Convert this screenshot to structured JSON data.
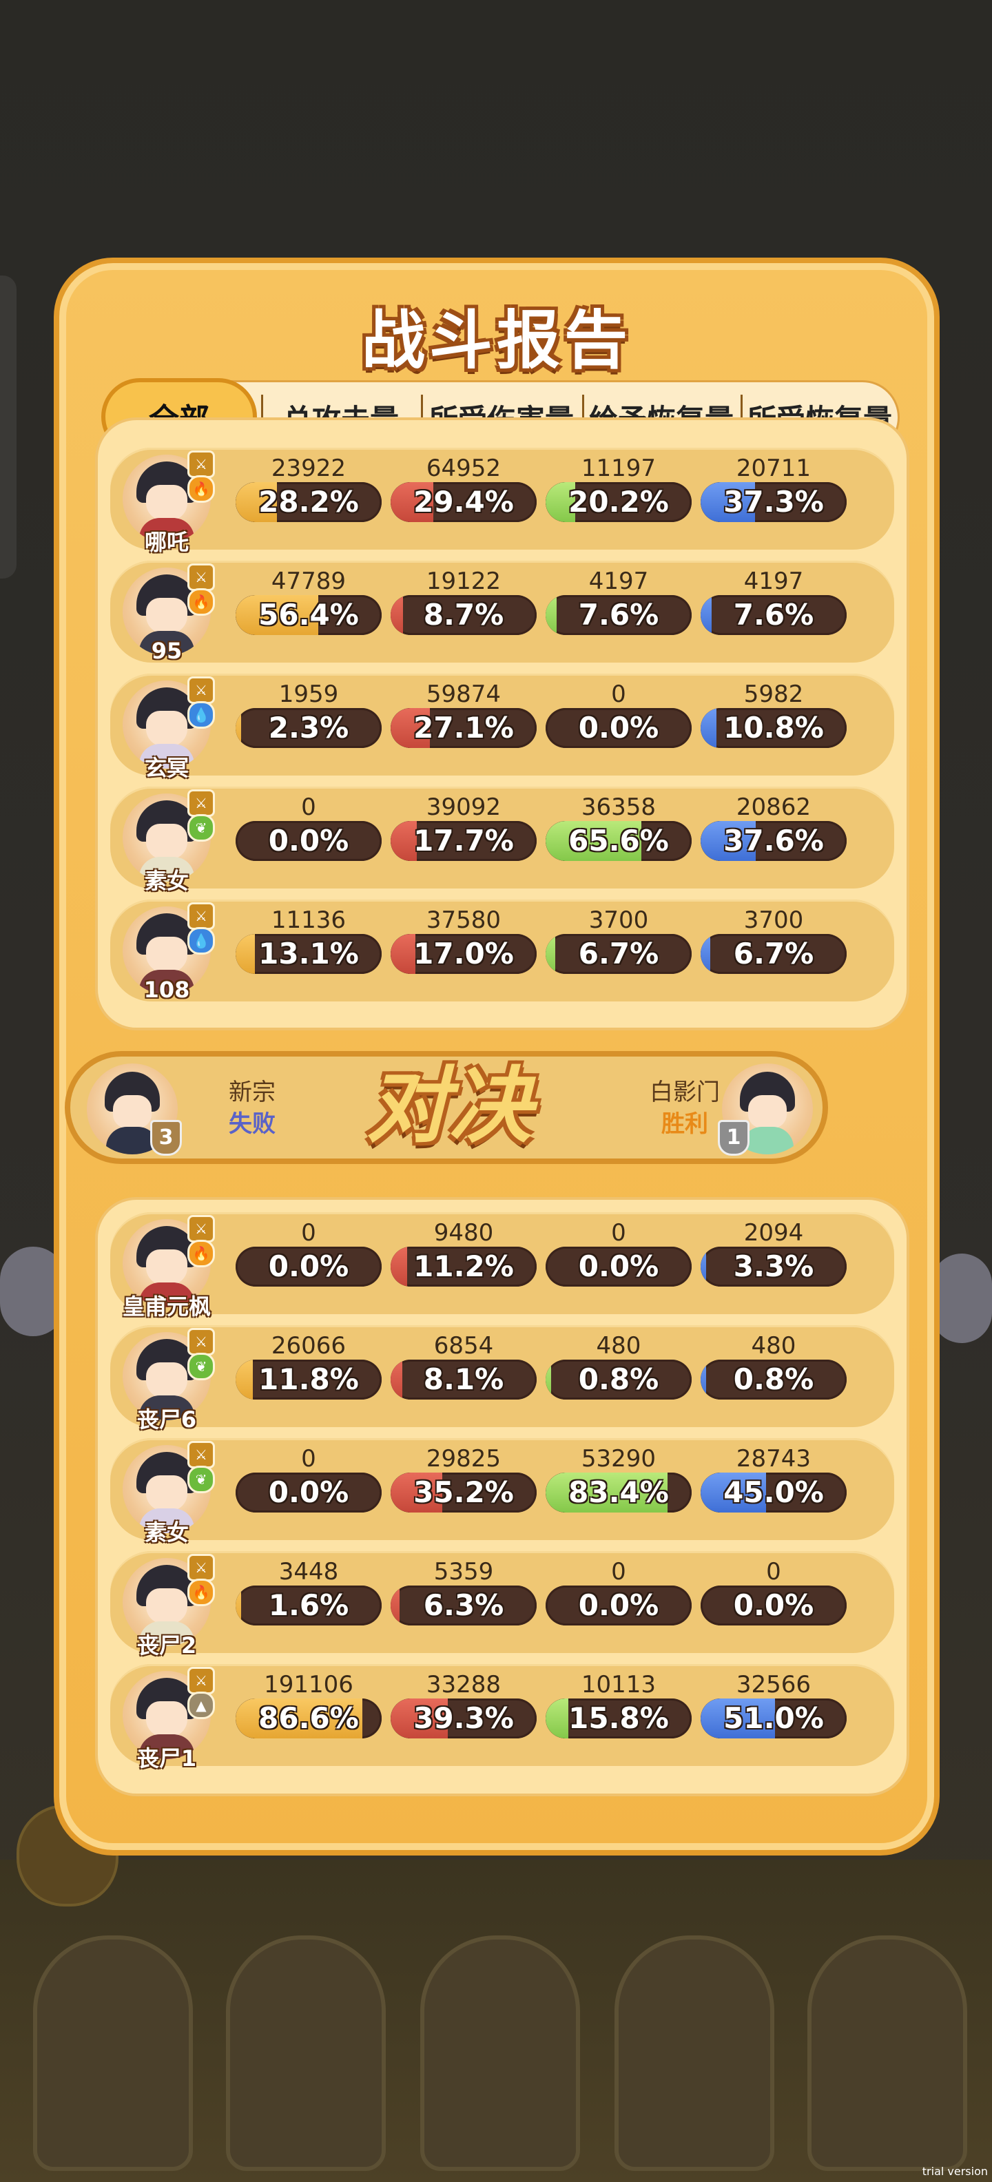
{
  "title": "战斗报告",
  "tabs": [
    "全部",
    "总攻击量",
    "所受伤害量",
    "给予恢复量",
    "所受恢复量"
  ],
  "versus": {
    "left": {
      "team": "新宗",
      "result": "失败",
      "rank": "3"
    },
    "logo": "对决",
    "right": {
      "team": "白影门",
      "result": "胜利",
      "rank": "1"
    }
  },
  "team_top": [
    {
      "name": "哪吒",
      "element": "fire",
      "stats": [
        {
          "v": "23922",
          "p": "28.2%",
          "f": 0.282
        },
        {
          "v": "64952",
          "p": "29.4%",
          "f": 0.294
        },
        {
          "v": "11197",
          "p": "20.2%",
          "f": 0.202
        },
        {
          "v": "20711",
          "p": "37.3%",
          "f": 0.373
        }
      ]
    },
    {
      "name": "95",
      "element": "fire",
      "stats": [
        {
          "v": "47789",
          "p": "56.4%",
          "f": 0.564
        },
        {
          "v": "19122",
          "p": "8.7%",
          "f": 0.087
        },
        {
          "v": "4197",
          "p": "7.6%",
          "f": 0.076
        },
        {
          "v": "4197",
          "p": "7.6%",
          "f": 0.076
        }
      ]
    },
    {
      "name": "玄冥",
      "element": "water",
      "stats": [
        {
          "v": "1959",
          "p": "2.3%",
          "f": 0.023
        },
        {
          "v": "59874",
          "p": "27.1%",
          "f": 0.271
        },
        {
          "v": "0",
          "p": "0.0%",
          "f": 0
        },
        {
          "v": "5982",
          "p": "10.8%",
          "f": 0.108
        }
      ]
    },
    {
      "name": "素女",
      "element": "wood",
      "stats": [
        {
          "v": "0",
          "p": "0.0%",
          "f": 0
        },
        {
          "v": "39092",
          "p": "17.7%",
          "f": 0.177
        },
        {
          "v": "36358",
          "p": "65.6%",
          "f": 0.656
        },
        {
          "v": "20862",
          "p": "37.6%",
          "f": 0.376
        }
      ]
    },
    {
      "name": "108",
      "element": "water",
      "stats": [
        {
          "v": "11136",
          "p": "13.1%",
          "f": 0.131
        },
        {
          "v": "37580",
          "p": "17.0%",
          "f": 0.17
        },
        {
          "v": "3700",
          "p": "6.7%",
          "f": 0.067
        },
        {
          "v": "3700",
          "p": "6.7%",
          "f": 0.067
        }
      ]
    }
  ],
  "team_bottom": [
    {
      "name": "皇甫元枫",
      "element": "fire",
      "stats": [
        {
          "v": "0",
          "p": "0.0%",
          "f": 0
        },
        {
          "v": "9480",
          "p": "11.2%",
          "f": 0.112
        },
        {
          "v": "0",
          "p": "0.0%",
          "f": 0
        },
        {
          "v": "2094",
          "p": "3.3%",
          "f": 0.033
        }
      ]
    },
    {
      "name": "丧尸6",
      "element": "wood",
      "stats": [
        {
          "v": "26066",
          "p": "11.8%",
          "f": 0.118
        },
        {
          "v": "6854",
          "p": "8.1%",
          "f": 0.081
        },
        {
          "v": "480",
          "p": "0.8%",
          "f": 0.008
        },
        {
          "v": "480",
          "p": "0.8%",
          "f": 0.008
        }
      ]
    },
    {
      "name": "素女",
      "element": "wood",
      "stats": [
        {
          "v": "0",
          "p": "0.0%",
          "f": 0
        },
        {
          "v": "29825",
          "p": "35.2%",
          "f": 0.352
        },
        {
          "v": "53290",
          "p": "83.4%",
          "f": 0.834
        },
        {
          "v": "28743",
          "p": "45.0%",
          "f": 0.45
        }
      ]
    },
    {
      "name": "丧尸2",
      "element": "fire",
      "stats": [
        {
          "v": "3448",
          "p": "1.6%",
          "f": 0.016
        },
        {
          "v": "5359",
          "p": "6.3%",
          "f": 0.063
        },
        {
          "v": "0",
          "p": "0.0%",
          "f": 0
        },
        {
          "v": "0",
          "p": "0.0%",
          "f": 0
        }
      ]
    },
    {
      "name": "丧尸1",
      "element": "earth",
      "stats": [
        {
          "v": "191106",
          "p": "86.6%",
          "f": 0.866
        },
        {
          "v": "33288",
          "p": "39.3%",
          "f": 0.393
        },
        {
          "v": "10113",
          "p": "15.8%",
          "f": 0.158
        },
        {
          "v": "32566",
          "p": "51.0%",
          "f": 0.51
        }
      ]
    }
  ],
  "element_colors": {
    "fire": "#f29a1e",
    "water": "#3b87e0",
    "wood": "#6cbb3c",
    "earth": "#9a8a6a"
  },
  "watermark": "trial version"
}
